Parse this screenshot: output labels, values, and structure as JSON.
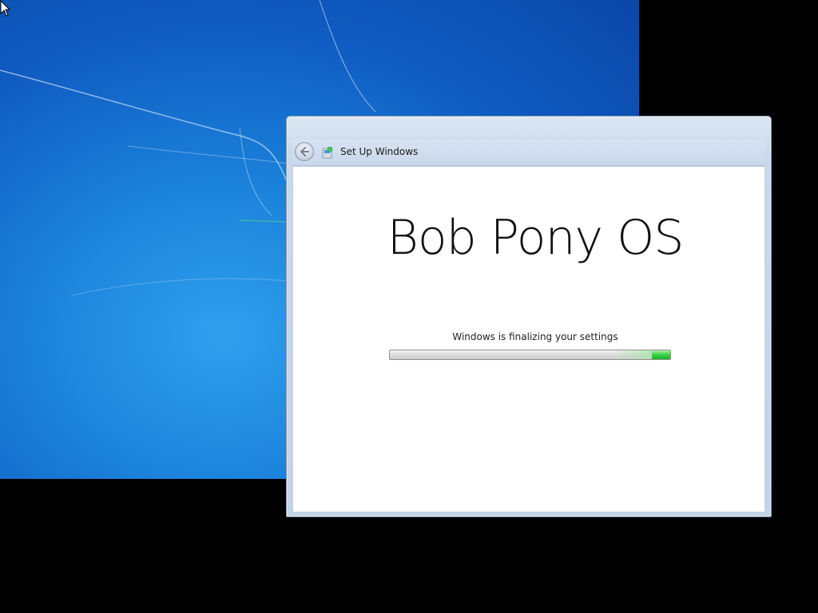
{
  "window": {
    "title": "Set Up Windows",
    "icons": {
      "back": "back-arrow-icon",
      "app": "setup-icon"
    }
  },
  "main": {
    "brand_title": "Bob Pony OS",
    "status_text": "Windows is finalizing your settings",
    "progress": {
      "value_fraction": 1.0,
      "animated_segment_fraction": 0.2,
      "fill_color": "#3ed34a"
    }
  },
  "desktop": {
    "background_color": "#1c84dc",
    "cursor_icon": "arrow-cursor-icon"
  }
}
